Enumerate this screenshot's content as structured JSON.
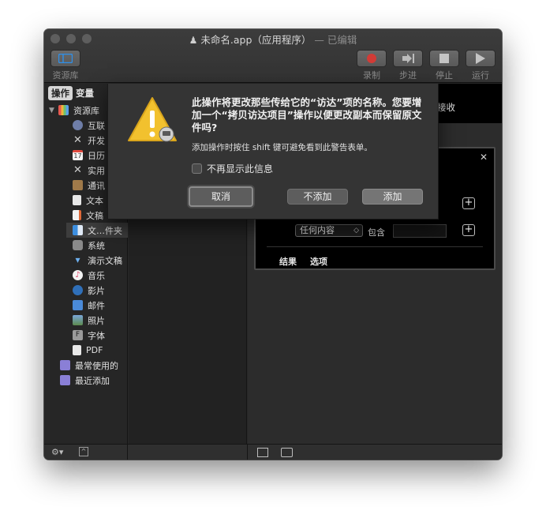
{
  "window": {
    "title": "未命名.app（应用程序）",
    "title_suffix": "— 已编辑"
  },
  "toolbar": {
    "library_label": "资源库",
    "record_label": "录制",
    "step_label": "步进",
    "stop_label": "停止",
    "run_label": "运行"
  },
  "sidebar": {
    "tabs": [
      "操作",
      "变量"
    ],
    "root_label": "资源库",
    "items": [
      {
        "label": "互联",
        "icon": "globe-icon"
      },
      {
        "label": "开发",
        "icon": "tools-icon"
      },
      {
        "label": "日历",
        "icon": "calendar-icon"
      },
      {
        "label": "实用",
        "icon": "utilities-icon"
      },
      {
        "label": "通讯",
        "icon": "contacts-icon"
      },
      {
        "label": "文本",
        "icon": "text-icon"
      },
      {
        "label": "文稿",
        "icon": "document-icon"
      },
      {
        "label": "文…件夹",
        "icon": "finder-icon"
      },
      {
        "label": "系统",
        "icon": "system-icon"
      },
      {
        "label": "演示文稿",
        "icon": "presentation-icon"
      },
      {
        "label": "音乐",
        "icon": "music-icon"
      },
      {
        "label": "影片",
        "icon": "movie-icon"
      },
      {
        "label": "邮件",
        "icon": "mail-icon"
      },
      {
        "label": "照片",
        "icon": "photo-icon"
      },
      {
        "label": "字体",
        "icon": "font-icon"
      },
      {
        "label": "PDF",
        "icon": "pdf-icon"
      }
    ],
    "smart_groups": [
      {
        "label": "最常使用的",
        "icon": "smart-folder-icon"
      },
      {
        "label": "最近添加",
        "icon": "smart-folder-icon"
      }
    ]
  },
  "workflow": {
    "header_truncated": "接收",
    "criteria_popup": "任何内容",
    "criteria_operator": "包含",
    "tabs": [
      "结果",
      "选项"
    ]
  },
  "alert": {
    "title": "此操作将更改那些传给它的“访达”项的名称。您要增加一个“拷贝访达项目”操作以便更改副本而保留原文件吗?",
    "info": "添加操作时按住 shift 键可避免看到此警告表单。",
    "suppress_label": "不再显示此信息",
    "cancel_label": "取消",
    "dont_add_label": "不添加",
    "add_label": "添加"
  },
  "colors": {
    "window_bg": "#272727",
    "record_red": "#d23b36",
    "warning_yellow": "#f2c12e"
  }
}
